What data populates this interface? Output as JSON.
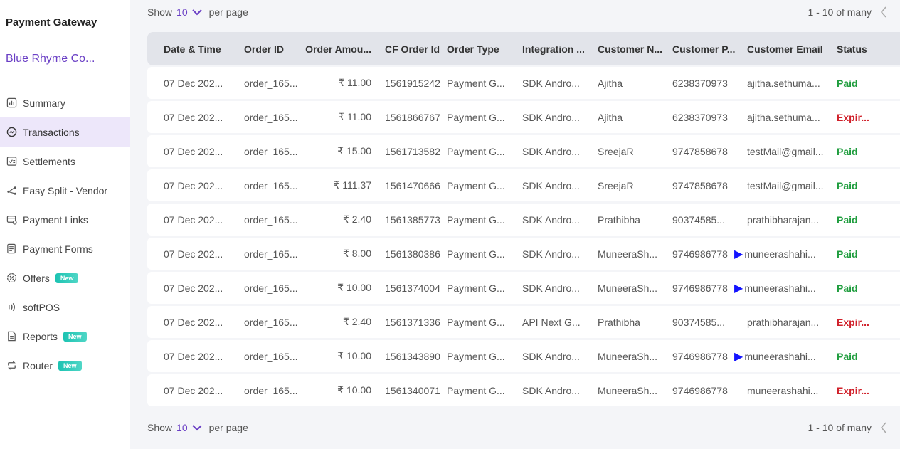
{
  "sidebar": {
    "product_title": "Payment Gateway",
    "merchant_name": "Blue Rhyme Co...",
    "items": [
      {
        "label": "Summary",
        "icon": "chart-icon",
        "badge": ""
      },
      {
        "label": "Transactions",
        "icon": "transactions-icon",
        "badge": "",
        "active": true
      },
      {
        "label": "Settlements",
        "icon": "settlements-icon",
        "badge": ""
      },
      {
        "label": "Easy Split - Vendor",
        "icon": "split-icon",
        "badge": ""
      },
      {
        "label": "Payment Links",
        "icon": "payment-links-icon",
        "badge": ""
      },
      {
        "label": "Payment Forms",
        "icon": "payment-forms-icon",
        "badge": ""
      },
      {
        "label": "Offers",
        "icon": "offers-icon",
        "badge": "New"
      },
      {
        "label": "softPOS",
        "icon": "softpos-icon",
        "badge": ""
      },
      {
        "label": "Reports",
        "icon": "reports-icon",
        "badge": "New"
      },
      {
        "label": "Router",
        "icon": "router-icon",
        "badge": "New"
      }
    ]
  },
  "pager": {
    "show_label": "Show",
    "page_size": "10",
    "per_page_label": "per page",
    "range_text": "1 - 10 of many"
  },
  "table": {
    "headers": [
      "Date & Time",
      "Order ID",
      "Order Amou...",
      "CF Order Id",
      "Order Type",
      "Integration ...",
      "Customer N...",
      "Customer P...",
      "Customer Email",
      "Status"
    ],
    "rows": [
      [
        "07 Dec 202...",
        "order_165...",
        "₹ 11.00",
        "1561915242",
        "Payment G...",
        "SDK Andro...",
        "Ajitha",
        "6238370973",
        "ajitha.sethuma...",
        "Paid"
      ],
      [
        "07 Dec 202...",
        "order_165...",
        "₹ 11.00",
        "1561866767",
        "Payment G...",
        "SDK Andro...",
        "Ajitha",
        "6238370973",
        "ajitha.sethuma...",
        "Expir..."
      ],
      [
        "07 Dec 202...",
        "order_165...",
        "₹ 15.00",
        "1561713582",
        "Payment G...",
        "SDK Andro...",
        "SreejaR",
        "9747858678",
        "testMail@gmail...",
        "Paid"
      ],
      [
        "07 Dec 202...",
        "order_165...",
        "₹ 111.37",
        "1561470666",
        "Payment G...",
        "SDK Andro...",
        "SreejaR",
        "9747858678",
        "testMail@gmail...",
        "Paid"
      ],
      [
        "07 Dec 202...",
        "order_165...",
        "₹ 2.40",
        "1561385773",
        "Payment G...",
        "SDK Andro...",
        "Prathibha",
        "90374585...",
        "prathibharajan...",
        "Paid"
      ],
      [
        "07 Dec 202...",
        "order_165...",
        "₹ 8.00",
        "1561380386",
        "Payment G...",
        "SDK Andro...",
        "MuneeraSh...",
        "9746986778",
        "muneerashahi...",
        "Paid"
      ],
      [
        "07 Dec 202...",
        "order_165...",
        "₹ 10.00",
        "1561374004",
        "Payment G...",
        "SDK Andro...",
        "MuneeraSh...",
        "9746986778",
        "muneerashahi...",
        "Paid"
      ],
      [
        "07 Dec 202...",
        "order_165...",
        "₹ 2.40",
        "1561371336",
        "Payment G...",
        "API Next G...",
        "Prathibha",
        "90374585...",
        "prathibharajan...",
        "Expir..."
      ],
      [
        "07 Dec 202...",
        "order_165...",
        "₹ 10.00",
        "1561343890",
        "Payment G...",
        "SDK Andro...",
        "MuneeraSh...",
        "9746986778",
        "muneerashahi...",
        "Paid"
      ],
      [
        "07 Dec 202...",
        "order_165...",
        "₹ 10.00",
        "1561340071",
        "Payment G...",
        "SDK Andro...",
        "MuneeraSh...",
        "9746986778",
        "muneerashahi...",
        "Expir..."
      ]
    ],
    "rows_with_arrow": [
      5,
      6,
      8
    ]
  },
  "colors": {
    "accent": "#6a3fc5",
    "active_bg": "#ede7fa",
    "paid": "#1f9d3e",
    "expired": "#d0202a",
    "badge": "#1cc3b2",
    "arrow": "#1414ff"
  }
}
